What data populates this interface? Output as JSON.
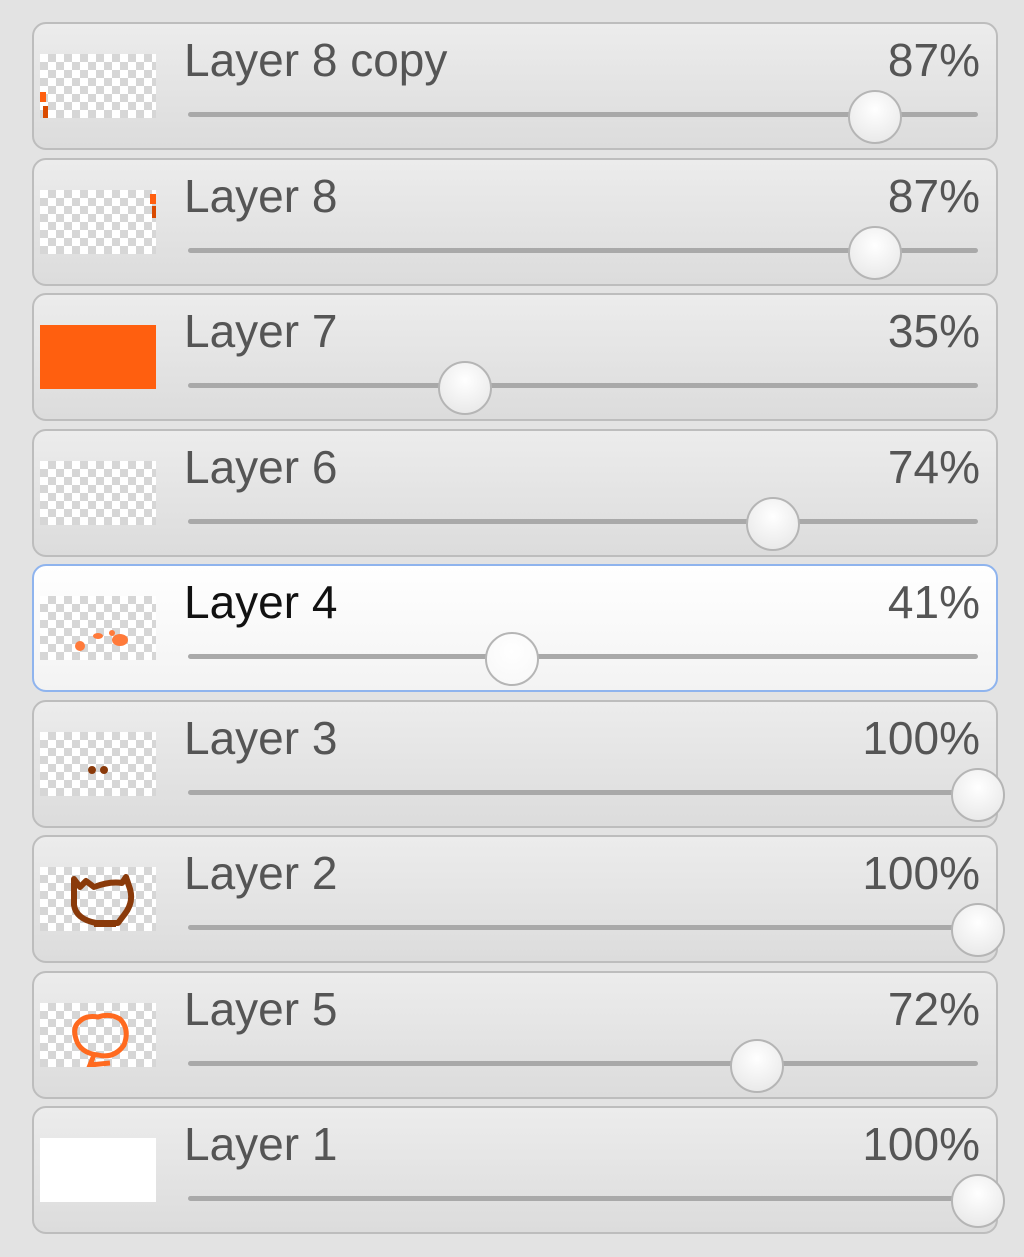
{
  "colors": {
    "accent_orange": "#ff5f0f",
    "dark_brown": "#8a3a0a",
    "selection_border": "#8fb4ee"
  },
  "layers": [
    {
      "name": "Layer 8 copy",
      "opacity_label": "87%",
      "opacity": 87,
      "selected": false,
      "thumbnail": "orange-edge-mark-left-icon"
    },
    {
      "name": "Layer 8",
      "opacity_label": "87%",
      "opacity": 87,
      "selected": false,
      "thumbnail": "orange-edge-mark-right-icon"
    },
    {
      "name": "Layer 7",
      "opacity_label": "35%",
      "opacity": 35,
      "selected": false,
      "thumbnail": "orange-fill-icon"
    },
    {
      "name": "Layer 6",
      "opacity_label": "74%",
      "opacity": 74,
      "selected": false,
      "thumbnail": "empty-transparent-icon"
    },
    {
      "name": "Layer 4",
      "opacity_label": "41%",
      "opacity": 41,
      "selected": true,
      "thumbnail": "orange-dots-icon"
    },
    {
      "name": "Layer 3",
      "opacity_label": "100%",
      "opacity": 100,
      "selected": false,
      "thumbnail": "brown-dots-icon"
    },
    {
      "name": "Layer 2",
      "opacity_label": "100%",
      "opacity": 100,
      "selected": false,
      "thumbnail": "brown-cat-outline-icon"
    },
    {
      "name": "Layer 5",
      "opacity_label": "72%",
      "opacity": 72,
      "selected": false,
      "thumbnail": "orange-head-outline-icon"
    },
    {
      "name": "Layer 1",
      "opacity_label": "100%",
      "opacity": 100,
      "selected": false,
      "thumbnail": "white-fill-icon"
    }
  ]
}
